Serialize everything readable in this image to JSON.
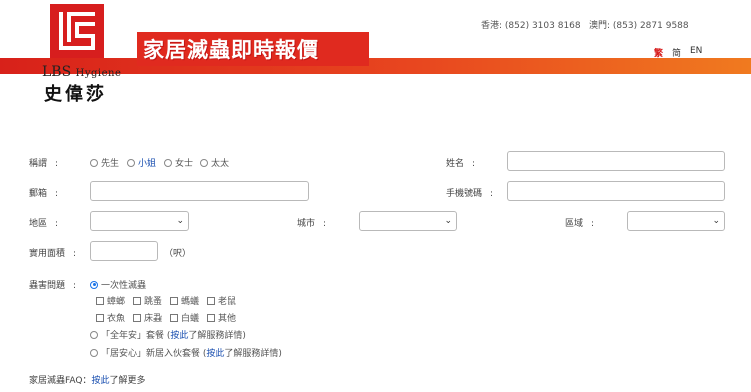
{
  "header": {
    "logo_en_main": "LBS",
    "logo_en_sub": "Hygiene",
    "logo_cn": "史偉莎",
    "banner_title": "家居滅蟲即時報價",
    "contact_hk": "香港: (852) 3103 8168",
    "contact_mo": "澳門: (853) 2871 9588",
    "lang": [
      {
        "label": "繁",
        "color": "#d71e1e"
      },
      {
        "label": "简",
        "color": "#333333"
      },
      {
        "label": "EN",
        "color": "#333333"
      }
    ]
  },
  "form": {
    "title_label": "稱謂",
    "title_options": [
      "先生",
      "小姐",
      "女士",
      "太太"
    ],
    "name_label": "姓名",
    "email_label": "郵箱",
    "phone_label": "手機號碼",
    "area_label": "地區",
    "city_label": "城市",
    "district_label": "區域",
    "size_label": "實用面積",
    "size_unit": "（呎）",
    "problem_label": "蟲害問題",
    "problem_option_one": "一次性滅蟲",
    "pests_row1": [
      "蟑螂",
      "跳蚤",
      "螞蟻",
      "老鼠"
    ],
    "pests_row2": [
      "衣魚",
      "床蝨",
      "白蟻",
      "其他"
    ],
    "plan_year_prefix": "「全年安」套餐 (",
    "plan_year_link": "按此",
    "plan_year_suffix": "了解服務詳情)",
    "plan_move_prefix": "「居安心」新居入伙套餐 (",
    "plan_move_link": "按此",
    "plan_move_suffix": "了解服務詳情)",
    "faq_prefix": "家居滅蟲FAQ：",
    "faq_link": "按此",
    "faq_suffix": "了解更多"
  },
  "colors": {
    "brand_red": "#d71e1e",
    "link_blue": "#1a4fb0",
    "stripe_orange": "#f07a1f"
  }
}
